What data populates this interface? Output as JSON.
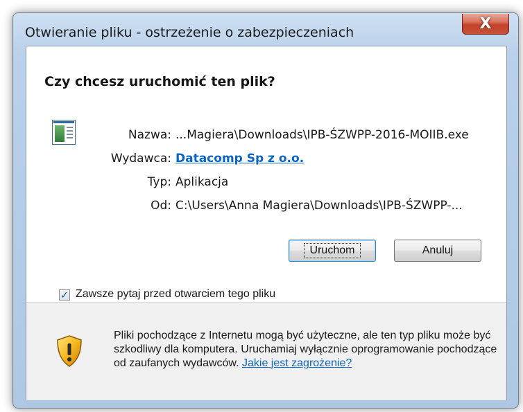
{
  "dialog": {
    "title": "Otwieranie pliku - ostrzeżenie o zabezpieczeniach",
    "close_label": "X",
    "question": "Czy chcesz uruchomić ten plik?",
    "file_icon": "application-file-icon",
    "info": [
      {
        "label": "Nazwa:",
        "value": "...Magiera\\Downloads\\IPB-ŚZWPP-2016-MOIIB.exe",
        "is_link": false
      },
      {
        "label": "Wydawca:",
        "value": "Datacomp Sp z o.o.",
        "is_link": true
      },
      {
        "label": "Typ:",
        "value": "Aplikacja",
        "is_link": false
      },
      {
        "label": "Od:",
        "value": "C:\\Users\\Anna Magiera\\Downloads\\IPB-ŚZWPP-...",
        "is_link": false
      }
    ],
    "buttons": {
      "run_label": "Uruchom",
      "cancel_label": "Anuluj"
    },
    "checkbox": {
      "label": "Zawsze pytaj przed otwarciem tego pliku",
      "checked": true
    },
    "warning": {
      "icon": "shield-warning-icon",
      "text": "Pliki pochodzące z Internetu mogą być użyteczne, ale ten typ pliku może być szkodliwy dla komputera. Uruchamiaj wyłącznie oprogramowanie pochodzące od zaufanych wydawców.",
      "link_text": "Jakie jest zagrożenie?"
    },
    "colors": {
      "link": "#0b65c2",
      "close_button": "#c3432a",
      "frame": "#b9d1ea"
    }
  }
}
